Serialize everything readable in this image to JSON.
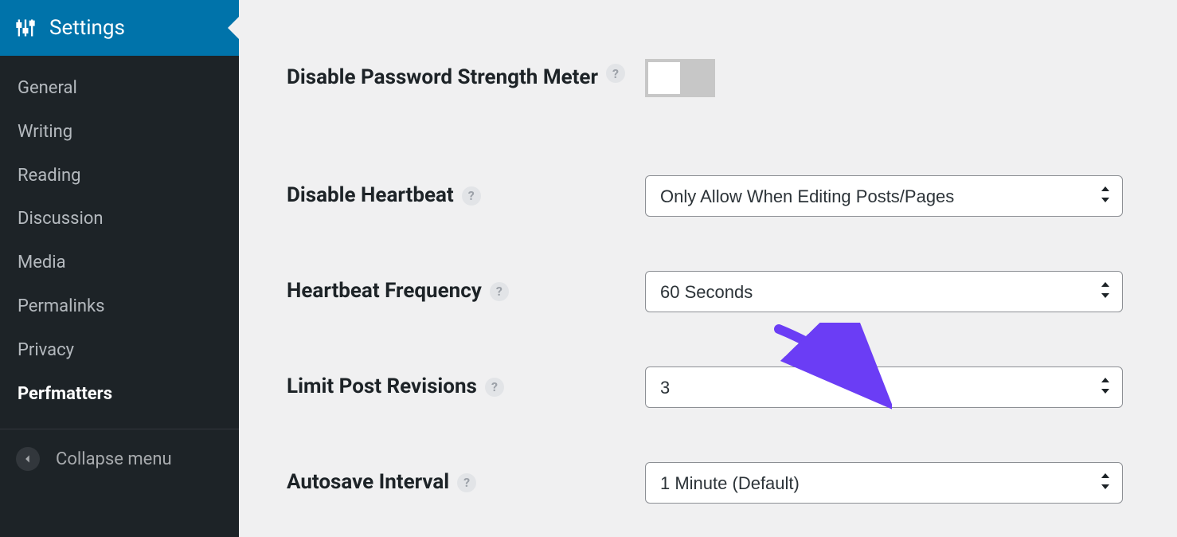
{
  "sidebar": {
    "title": "Settings",
    "items": [
      {
        "label": "General",
        "active": false
      },
      {
        "label": "Writing",
        "active": false
      },
      {
        "label": "Reading",
        "active": false
      },
      {
        "label": "Discussion",
        "active": false
      },
      {
        "label": "Media",
        "active": false
      },
      {
        "label": "Permalinks",
        "active": false
      },
      {
        "label": "Privacy",
        "active": false
      },
      {
        "label": "Perfmatters",
        "active": true
      }
    ],
    "collapse_label": "Collapse menu"
  },
  "settings": {
    "disable_pwd_meter": {
      "label": "Disable Password Strength Meter",
      "value": false
    },
    "disable_heartbeat": {
      "label": "Disable Heartbeat",
      "value": "Only Allow When Editing Posts/Pages"
    },
    "heartbeat_frequency": {
      "label": "Heartbeat Frequency",
      "value": "60 Seconds"
    },
    "limit_revisions": {
      "label": "Limit Post Revisions",
      "value": "3"
    },
    "autosave_interval": {
      "label": "Autosave Interval",
      "value": "1 Minute (Default)"
    }
  },
  "help_glyph": "?",
  "colors": {
    "accent": "#0073aa",
    "annotation": "#6b3df5"
  }
}
